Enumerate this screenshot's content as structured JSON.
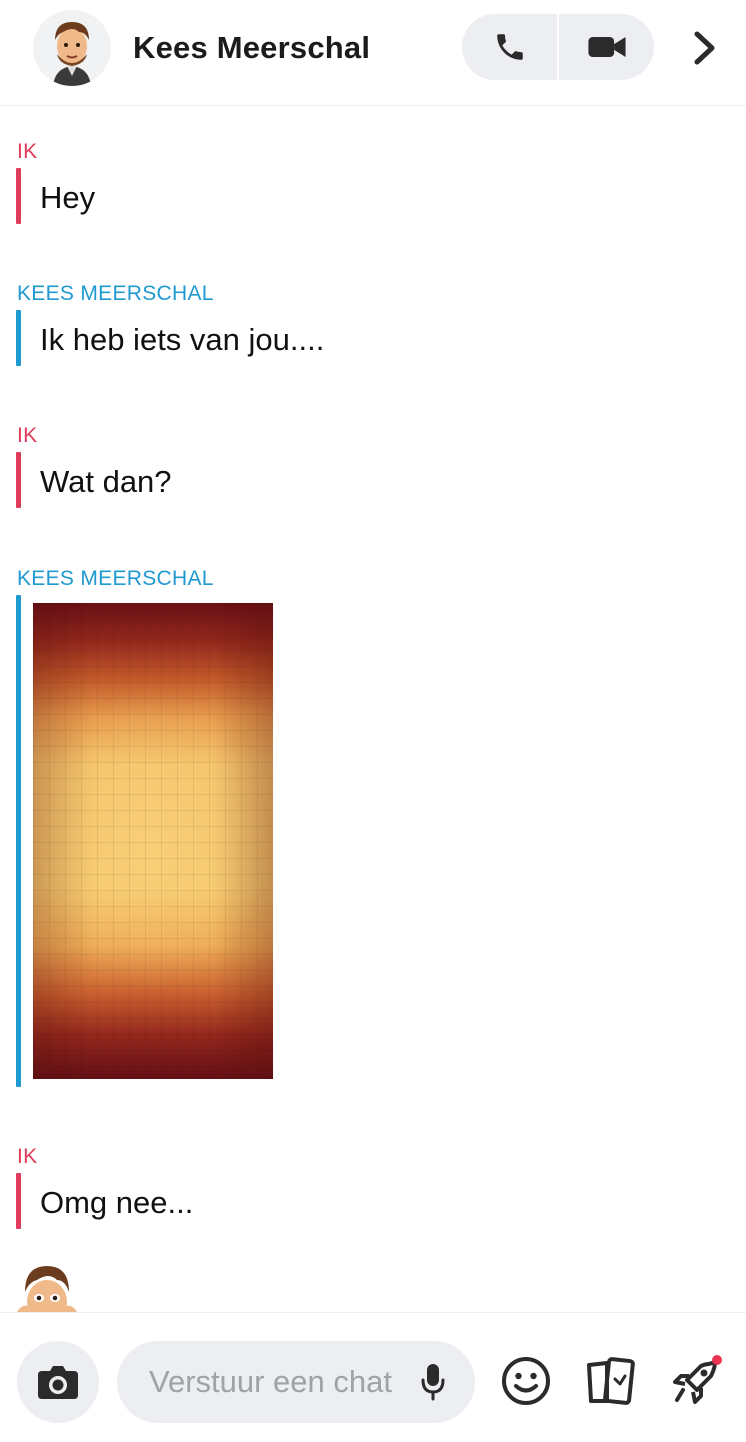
{
  "header": {
    "contact_name": "Kees Meerschal"
  },
  "messages": [
    {
      "sender": "IK",
      "text": "Hey"
    },
    {
      "sender": "KEES MEERSCHAL",
      "text": "Ik heb iets van jou...."
    },
    {
      "sender": "IK",
      "text": "Wat dan?"
    },
    {
      "sender": "KEES MEERSCHAL"
    },
    {
      "sender": "IK",
      "text": "Omg nee..."
    }
  ],
  "composer": {
    "placeholder": "Verstuur een chat"
  },
  "colors": {
    "me": "#de3c5a",
    "them": "#1f9ad1",
    "pill_bg": "#eceef1",
    "icon": "#2b2b2b"
  },
  "icons": {
    "call": "phone-icon",
    "video": "video-camera-icon",
    "forward": "chevron-right-icon",
    "camera": "camera-icon",
    "mic": "microphone-icon",
    "emoji": "smiley-icon",
    "stickers": "cards-icon",
    "games": "rocket-icon"
  }
}
